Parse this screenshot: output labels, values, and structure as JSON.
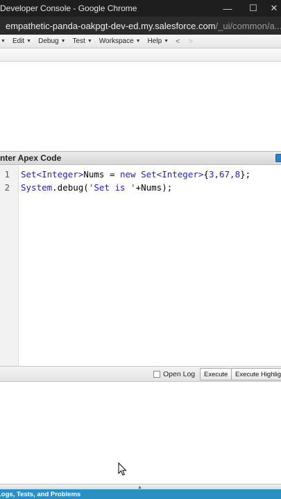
{
  "window": {
    "title": "Developer Console - Google Chrome",
    "minimize": "—",
    "maximize": "☐",
    "close": "✕"
  },
  "address": {
    "host": "empathetic-panda-oakpgt-dev-ed.my.salesforce.com",
    "path": "/_ui/common/a..."
  },
  "menubar": {
    "items": [
      {
        "label": "Edit"
      },
      {
        "label": "Debug"
      },
      {
        "label": "Test"
      },
      {
        "label": "Workspace"
      },
      {
        "label": "Help"
      }
    ],
    "back": "<",
    "forward": ">"
  },
  "apex": {
    "title": "Enter Apex Code",
    "lines": [
      {
        "no": "1",
        "tokens": [
          {
            "t": "Set<Integer>",
            "c": "kw"
          },
          {
            "t": "Nums = ",
            "c": ""
          },
          {
            "t": "new Set<Integer>",
            "c": "kw"
          },
          {
            "t": "{",
            "c": ""
          },
          {
            "t": "3,67,8",
            "c": "num"
          },
          {
            "t": "};",
            "c": ""
          }
        ]
      },
      {
        "no": "2",
        "tokens": [
          {
            "t": "System",
            "c": "kw"
          },
          {
            "t": ".debug(",
            "c": ""
          },
          {
            "t": "'Set is '",
            "c": "str"
          },
          {
            "t": "+Nums);",
            "c": ""
          }
        ]
      }
    ]
  },
  "execbar": {
    "open_log": "Open Log",
    "execute": "Execute",
    "execute_highlighted": "Execute Highlighted"
  },
  "status": {
    "label": "Logs, Tests, and Problems"
  },
  "colors": {
    "status_bar": "#2b8fc3",
    "keyword": "#1f1fb8"
  }
}
